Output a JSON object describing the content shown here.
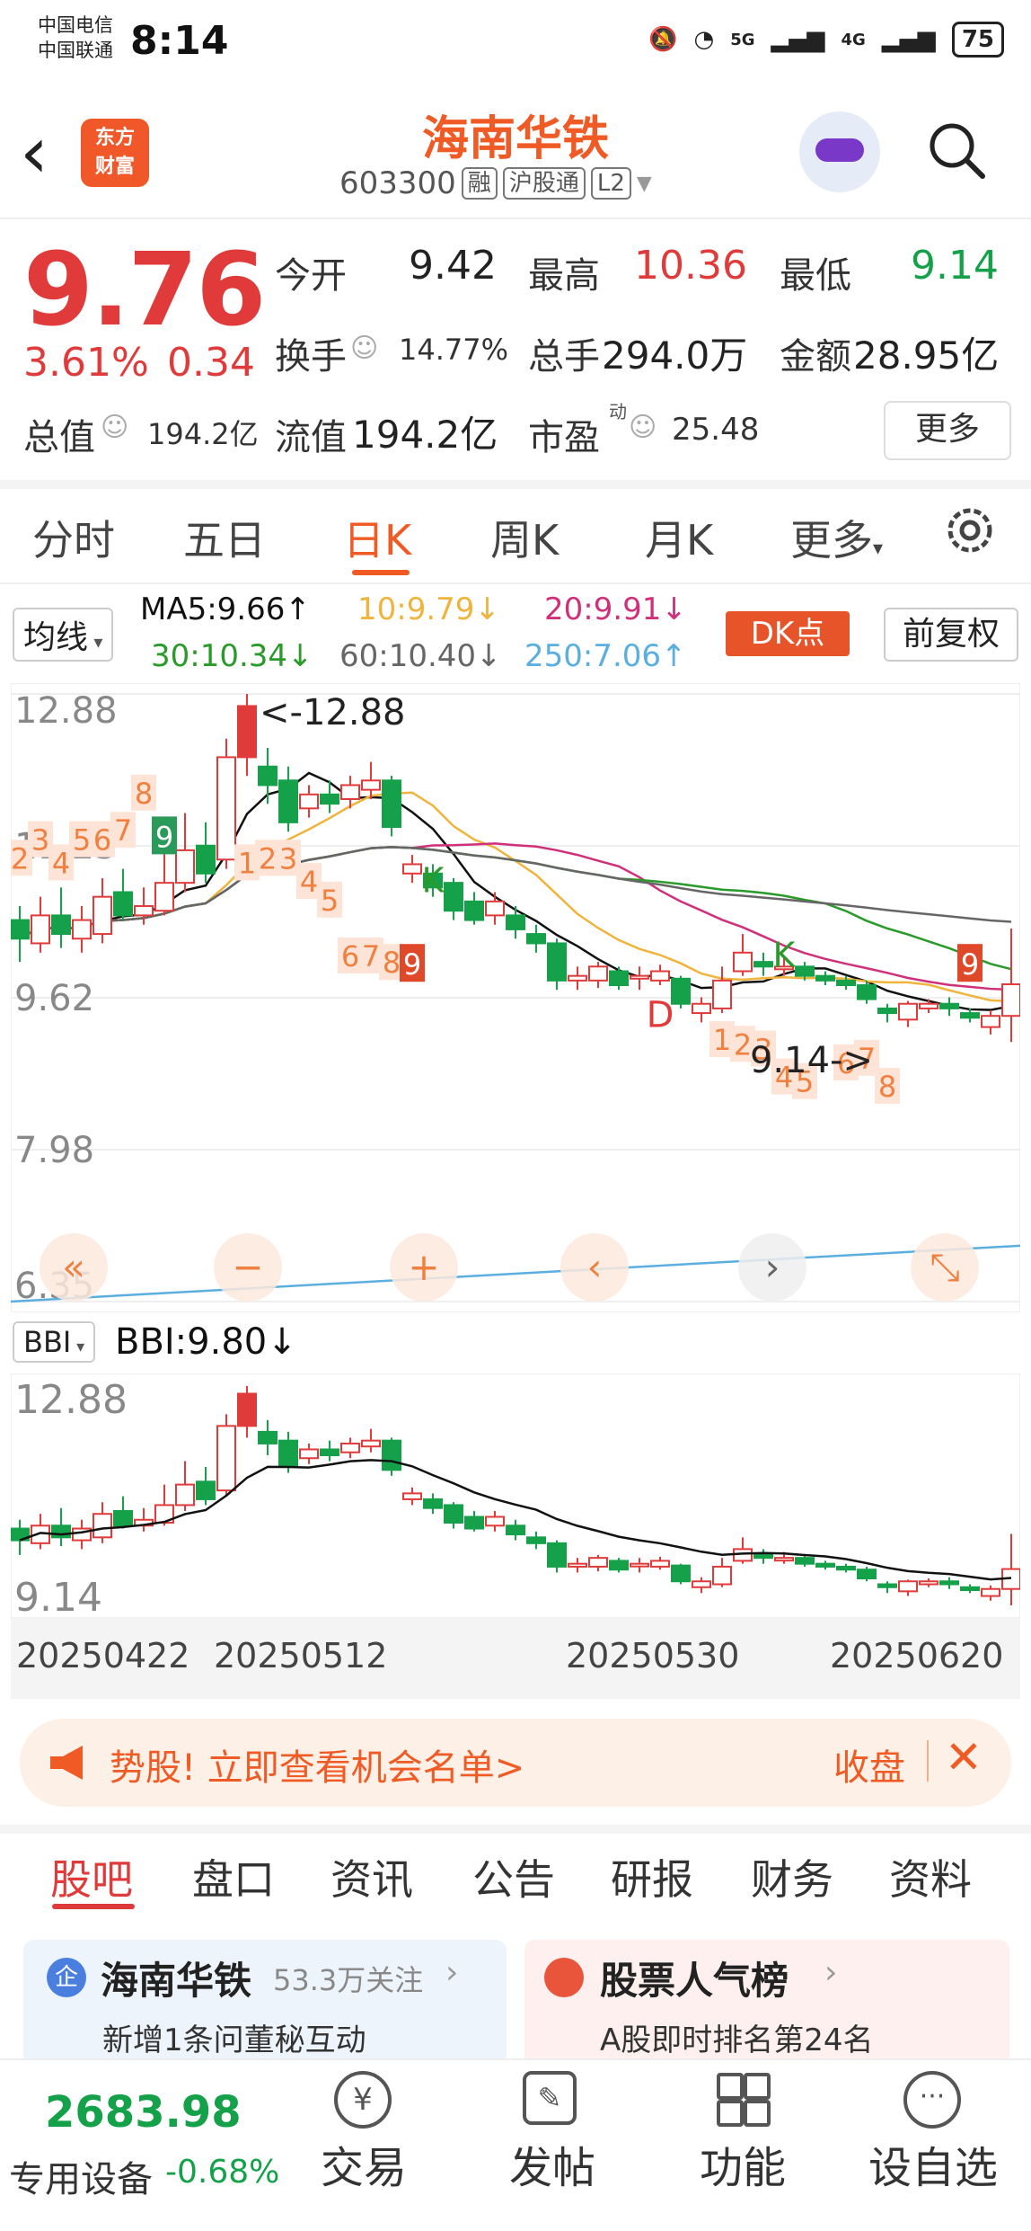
{
  "status_bar": {
    "carrier1": "中国电信",
    "carrier2": "中国联通",
    "time": "8:14",
    "net1": "5G",
    "net2": "4G",
    "battery": "75"
  },
  "header": {
    "logo_line1": "东方",
    "logo_line2": "财富",
    "stock_name": "海南华铁",
    "code": "603300",
    "tag_rong": "融",
    "tag_hgt": "沪股通",
    "tag_l2": "L2"
  },
  "quote": {
    "price": "9.76",
    "change_pct": "3.61%",
    "change_amt": "0.34",
    "open_label": "今开",
    "open": "9.42",
    "high_label": "最高",
    "high": "10.36",
    "low_label": "最低",
    "low": "9.14",
    "turnover_label": "换手",
    "turnover": "14.77%",
    "volume_label": "总手",
    "volume": "294.0万",
    "amount_label": "金额",
    "amount": "28.95亿",
    "mktcap_label": "总值",
    "mktcap": "194.2亿",
    "float_label": "流值",
    "float": "194.2亿",
    "pe_label": "市盈",
    "pe_sup": "动",
    "pe": "25.48",
    "more": "更多"
  },
  "tabs": [
    "分时",
    "五日",
    "日K",
    "周K",
    "月K",
    "更多"
  ],
  "active_tab": "日K",
  "ma_row": {
    "select": "均线",
    "ma5": "MA5:9.66↑",
    "ma10": "10:9.79↓",
    "ma20": "20:9.91↓",
    "ma30": "30:10.34↓",
    "ma60": "60:10.40↓",
    "ma250": "250:7.06↑",
    "dk_button": "DK点",
    "adjust_button": "前复权"
  },
  "colors": {
    "up": "#e03a3a",
    "down": "#14a14a",
    "ma5": "#111111",
    "ma10": "#f0b43c",
    "ma20": "#d0307a",
    "ma30": "#2a9a2a",
    "ma60": "#666666",
    "ma250": "#5aaee0",
    "accent": "#f05a25"
  },
  "chart_data": [
    {
      "type": "candlestick",
      "y_labels": [
        "12.88",
        "11.25",
        "9.62",
        "7.98",
        "6.35"
      ],
      "ylim": [
        6.35,
        12.88
      ],
      "max_marker": "<-12.88",
      "min_marker": "9.14->",
      "candles": [
        {
          "o": 10.45,
          "c": 10.25,
          "h": 10.6,
          "l": 10.0
        },
        {
          "o": 10.2,
          "c": 10.5,
          "h": 10.7,
          "l": 10.1
        },
        {
          "o": 10.5,
          "c": 10.3,
          "h": 10.8,
          "l": 10.15
        },
        {
          "o": 10.25,
          "c": 10.45,
          "h": 10.6,
          "l": 10.1
        },
        {
          "o": 10.3,
          "c": 10.7,
          "h": 10.9,
          "l": 10.2
        },
        {
          "o": 10.75,
          "c": 10.5,
          "h": 11.0,
          "l": 10.45
        },
        {
          "o": 10.5,
          "c": 10.6,
          "h": 10.8,
          "l": 10.4
        },
        {
          "o": 10.55,
          "c": 10.85,
          "h": 11.2,
          "l": 10.5
        },
        {
          "o": 10.85,
          "c": 11.2,
          "h": 11.6,
          "l": 10.75
        },
        {
          "o": 11.25,
          "c": 10.95,
          "h": 11.5,
          "l": 10.85
        },
        {
          "o": 11.1,
          "c": 12.2,
          "h": 12.4,
          "l": 11.0
        },
        {
          "o": 12.2,
          "c": 12.75,
          "h": 12.88,
          "l": 12.0
        },
        {
          "o": 12.1,
          "c": 11.9,
          "h": 12.3,
          "l": 11.7
        },
        {
          "o": 11.95,
          "c": 11.5,
          "h": 12.1,
          "l": 11.4
        },
        {
          "o": 11.65,
          "c": 11.8,
          "h": 11.9,
          "l": 11.55
        },
        {
          "o": 11.8,
          "c": 11.7,
          "h": 11.95,
          "l": 11.6
        },
        {
          "o": 11.75,
          "c": 11.9,
          "h": 12.0,
          "l": 11.65
        },
        {
          "o": 11.85,
          "c": 11.95,
          "h": 12.15,
          "l": 11.75
        },
        {
          "o": 11.95,
          "c": 11.45,
          "h": 12.0,
          "l": 11.35
        },
        {
          "o": 10.95,
          "c": 11.05,
          "h": 11.15,
          "l": 10.85
        },
        {
          "o": 10.95,
          "c": 10.8,
          "h": 11.05,
          "l": 10.7
        },
        {
          "o": 10.85,
          "c": 10.55,
          "h": 10.9,
          "l": 10.45
        },
        {
          "o": 10.65,
          "c": 10.45,
          "h": 10.75,
          "l": 10.4
        },
        {
          "o": 10.5,
          "c": 10.65,
          "h": 10.75,
          "l": 10.4
        },
        {
          "o": 10.5,
          "c": 10.35,
          "h": 10.6,
          "l": 10.25
        },
        {
          "o": 10.3,
          "c": 10.2,
          "h": 10.4,
          "l": 10.1
        },
        {
          "o": 10.2,
          "c": 9.8,
          "h": 10.25,
          "l": 9.7
        },
        {
          "o": 9.8,
          "c": 9.85,
          "h": 9.95,
          "l": 9.7
        },
        {
          "o": 9.8,
          "c": 9.95,
          "h": 10.0,
          "l": 9.72
        },
        {
          "o": 9.9,
          "c": 9.75,
          "h": 9.95,
          "l": 9.7
        },
        {
          "o": 9.82,
          "c": 9.85,
          "h": 9.95,
          "l": 9.7
        },
        {
          "o": 9.8,
          "c": 9.9,
          "h": 9.97,
          "l": 9.75
        },
        {
          "o": 9.82,
          "c": 9.55,
          "h": 9.85,
          "l": 9.5
        },
        {
          "o": 9.45,
          "c": 9.55,
          "h": 9.62,
          "l": 9.35
        },
        {
          "o": 9.5,
          "c": 9.8,
          "h": 9.95,
          "l": 9.45
        },
        {
          "o": 9.9,
          "c": 10.1,
          "h": 10.3,
          "l": 9.85
        },
        {
          "o": 10.0,
          "c": 9.95,
          "h": 10.1,
          "l": 9.85
        },
        {
          "o": 9.95,
          "c": 9.95,
          "h": 10.05,
          "l": 9.85
        },
        {
          "o": 9.95,
          "c": 9.85,
          "h": 10.0,
          "l": 9.8
        },
        {
          "o": 9.85,
          "c": 9.8,
          "h": 9.9,
          "l": 9.75
        },
        {
          "o": 9.8,
          "c": 9.75,
          "h": 9.85,
          "l": 9.7
        },
        {
          "o": 9.75,
          "c": 9.6,
          "h": 9.8,
          "l": 9.55
        },
        {
          "o": 9.5,
          "c": 9.45,
          "h": 9.55,
          "l": 9.35
        },
        {
          "o": 9.38,
          "c": 9.55,
          "h": 9.58,
          "l": 9.3
        },
        {
          "o": 9.5,
          "c": 9.55,
          "h": 9.6,
          "l": 9.45
        },
        {
          "o": 9.55,
          "c": 9.5,
          "h": 9.62,
          "l": 9.42
        },
        {
          "o": 9.45,
          "c": 9.4,
          "h": 9.5,
          "l": 9.35
        },
        {
          "o": 9.3,
          "c": 9.42,
          "h": 9.48,
          "l": 9.22
        },
        {
          "o": 9.42,
          "c": 9.76,
          "h": 10.36,
          "l": 9.14
        }
      ],
      "buy_labels": [
        {
          "t": "2",
          "i": 0,
          "y": 11.1
        },
        {
          "t": "3",
          "i": 1,
          "y": 11.3
        },
        {
          "t": "4",
          "i": 2,
          "y": 11.05
        },
        {
          "t": "5",
          "i": 3,
          "y": 11.3
        },
        {
          "t": "6",
          "i": 4,
          "y": 11.3
        },
        {
          "t": "7",
          "i": 5,
          "y": 11.4
        },
        {
          "t": "8",
          "i": 6,
          "y": 11.8
        },
        {
          "t": "1",
          "i": 11,
          "y": 11.05
        },
        {
          "t": "2",
          "i": 12,
          "y": 11.1
        },
        {
          "t": "3",
          "i": 13,
          "y": 11.1
        },
        {
          "t": "4",
          "i": 14,
          "y": 10.85
        },
        {
          "t": "5",
          "i": 15,
          "y": 10.65
        },
        {
          "t": "6",
          "i": 16,
          "y": 10.05
        },
        {
          "t": "7",
          "i": 17,
          "y": 10.05
        },
        {
          "t": "8",
          "i": 18,
          "y": 9.98
        },
        {
          "t": "1",
          "i": 34,
          "y": 9.15
        },
        {
          "t": "2",
          "i": 35,
          "y": 9.1
        },
        {
          "t": "3",
          "i": 36,
          "y": 9.05
        },
        {
          "t": "4",
          "i": 37,
          "y": 8.75
        },
        {
          "t": "5",
          "i": 38,
          "y": 8.7
        },
        {
          "t": "6",
          "i": 40,
          "y": 8.9
        },
        {
          "t": "7",
          "i": 41,
          "y": 8.95
        },
        {
          "t": "8",
          "i": 42,
          "y": 8.65
        }
      ],
      "nine_green": {
        "t": "9",
        "i": 7
      },
      "nine_red": [
        {
          "t": "9",
          "i": 19
        },
        {
          "t": "9",
          "i": 46
        }
      ],
      "k_markers": [
        {
          "t": "K",
          "i": 20,
          "y": 10.75
        },
        {
          "t": "K",
          "i": 37,
          "y": 9.95
        }
      ],
      "d_marker": {
        "t": "D",
        "i": 31,
        "y": 9.3
      },
      "zoom_controls": [
        "«",
        "−",
        "+",
        "‹",
        "›",
        "⤡"
      ]
    },
    {
      "type": "candlestick",
      "indicator": "BBI",
      "select": "BBI",
      "value_text": "BBI:9.80↓",
      "y_labels": [
        "12.88",
        "9.14"
      ],
      "ylim": [
        9.14,
        12.88
      ],
      "x_labels": [
        "20250422",
        "20250512",
        "20250530",
        "20250620"
      ]
    }
  ],
  "banner": {
    "text": "势股!  立即查看机会名单>",
    "close_text": "收盘"
  },
  "bottom_tabs": [
    "股吧",
    "盘口",
    "资讯",
    "公告",
    "研报",
    "财务",
    "资料"
  ],
  "cards": {
    "left_icon": "企",
    "left_title": "海南华铁",
    "left_follow": "53.3万关注",
    "left_sub": "新增1条问董秘互动",
    "right_title": "股票人气榜",
    "right_sub": "A股即时排名第24名"
  },
  "footer": {
    "index_value": "2683.98",
    "sector": "专用设备",
    "sector_change": "-0.68%",
    "items": [
      "交易",
      "发帖",
      "功能",
      "设自选"
    ]
  }
}
